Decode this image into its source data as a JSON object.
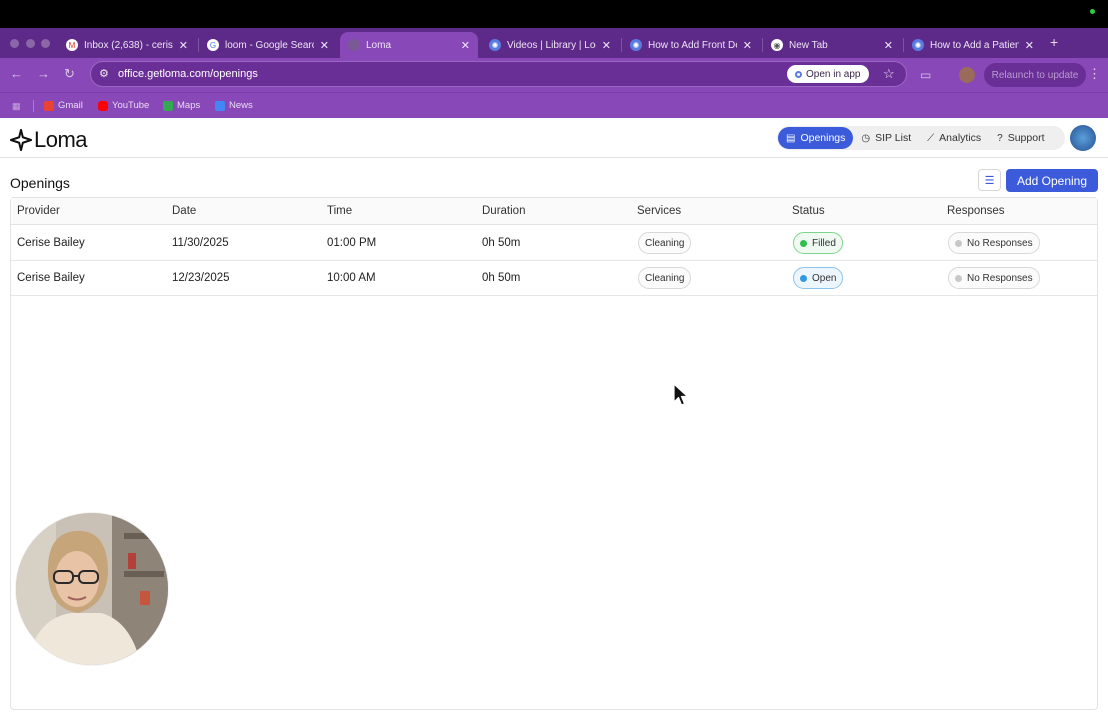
{
  "browser": {
    "tabs": [
      {
        "title": "Inbox (2,638) - ceris",
        "icon": "gmail-icon",
        "active": false
      },
      {
        "title": "loom - Google Search",
        "icon": "google-icon",
        "active": false
      },
      {
        "title": "Loma",
        "icon": "loma-icon",
        "active": true
      },
      {
        "title": "Videos | Library | Loom",
        "icon": "loom-icon",
        "active": false
      },
      {
        "title": "How to Add Front Desk",
        "icon": "loom-icon",
        "active": false
      },
      {
        "title": "New Tab",
        "icon": "chrome-icon",
        "active": false
      },
      {
        "title": "How to Add a Patient",
        "icon": "loom-icon",
        "active": false
      }
    ],
    "url": "office.getloma.com/openings",
    "open_in_app": "Open in app",
    "relaunch": "Relaunch to update",
    "bookmarks": [
      "Gmail",
      "YouTube",
      "Maps",
      "News"
    ]
  },
  "app": {
    "logo_text": "Loma",
    "nav": [
      {
        "label": "Openings",
        "icon": "calendar-icon",
        "active": true
      },
      {
        "label": "SIP List",
        "icon": "clock-icon",
        "active": false
      },
      {
        "label": "Analytics",
        "icon": "chart-icon",
        "active": false
      },
      {
        "label": "Support",
        "icon": "help-icon",
        "active": false
      }
    ]
  },
  "openings": {
    "title": "Openings",
    "add_button": "Add Opening",
    "columns": [
      "Provider",
      "Date",
      "Time",
      "Duration",
      "Services",
      "Status",
      "Responses"
    ],
    "rows": [
      {
        "provider": "Cerise Bailey",
        "date": "11/30/2025",
        "time": "01:00 PM",
        "duration": "0h 50m",
        "service": "Cleaning",
        "status": "Filled",
        "responses": "No Responses"
      },
      {
        "provider": "Cerise Bailey",
        "date": "12/23/2025",
        "time": "10:00 AM",
        "duration": "0h 50m",
        "service": "Cleaning",
        "status": "Open",
        "responses": "No Responses"
      }
    ]
  },
  "colors": {
    "browser_frame": "#5e2a8a",
    "accent": "#3b5bdb",
    "status_filled": "#2fbf4f",
    "status_open": "#2f9ae0",
    "no_response": "#c8c8c8"
  }
}
